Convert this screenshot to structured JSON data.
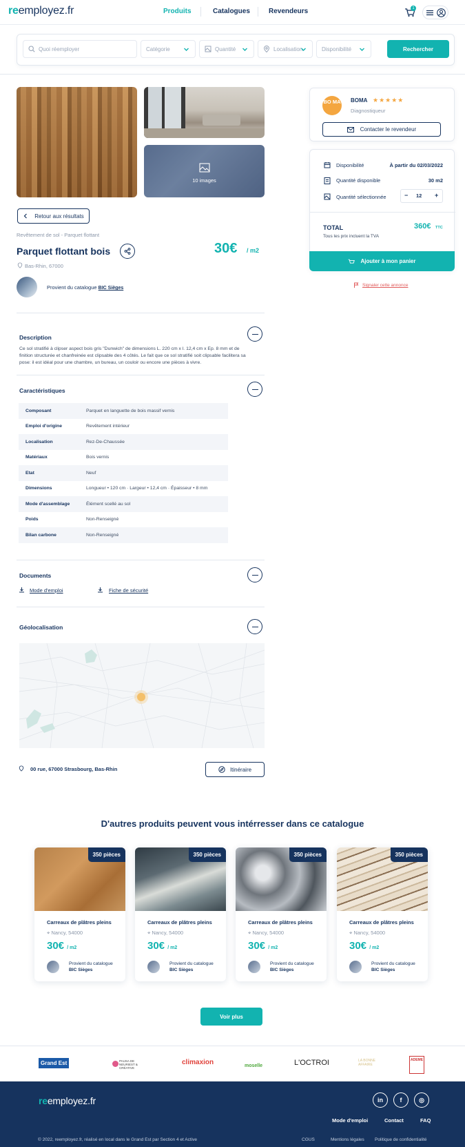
{
  "header": {
    "logo_re": "re",
    "logo_rest": "employez.fr",
    "nav": [
      "Produits",
      "Catalogues",
      "Revendeurs"
    ],
    "cart_count": "1"
  },
  "search": {
    "query_placeholder": "Quoi réemployer",
    "category": "Catégorie",
    "quantity": "Quantité",
    "location": "Localisation",
    "availability": "Disponibilité",
    "button": "Rechercher"
  },
  "gallery": {
    "more_images": "10 images"
  },
  "product": {
    "back": "Retour aux résultats",
    "breadcrumb": "Revêtement de sol - Parquet flottant",
    "title": "Parquet flottant bois",
    "price": "30€",
    "unit": "/ m2",
    "location": "Bas-Rhin, 67000",
    "catalogue_prefix": "Provient du catalogue",
    "catalogue_name": "BIC Sièges"
  },
  "description": {
    "title": "Description",
    "text": "Ce sol stratifié à clipser aspect bois gris \"Dunwich\" de dimensions L. 220 cm x l. 12,4 cm x Ep. 8 mm et de finition structurée et chanfreinée est clipsable des 4 côtés. Le fait que ce sol stratifié soit clipsable facilitera sa pose: il est idéal pour une chambre, un bureau, un couloir ou encore une pièces à vivre."
  },
  "characteristics": {
    "title": "Caractéristiques",
    "rows": [
      {
        "k": "Composant",
        "v": "Parquet en languette de bois massif vernis"
      },
      {
        "k": "Emploi d'origine",
        "v": "Revêtement intérieur"
      },
      {
        "k": "Localisation",
        "v": "Rez-De-Chaussée"
      },
      {
        "k": "Matériaux",
        "v": "Bois vernis"
      },
      {
        "k": "Etat",
        "v": "Neuf"
      },
      {
        "k": "Dimensions",
        "v": "Longueur • 120 cm · Largeur • 12,4 cm · Épaisseur • 8 mm"
      },
      {
        "k": "Mode d'assemblage",
        "v": "Élément scellé au sol"
      },
      {
        "k": "Poids",
        "v": "Non-Renseigné"
      },
      {
        "k": "Bilan carbone",
        "v": "Non-Renseigné"
      }
    ]
  },
  "documents": {
    "title": "Documents",
    "items": [
      "Mode d'emploi",
      "Fiche de sécurité"
    ]
  },
  "geo": {
    "title": "Géolocalisation",
    "address": "00 rue, 67000 Strasbourg, Bas-Rhin",
    "itinerary": "Itinéraire"
  },
  "seller": {
    "name": "BOMA",
    "stars": "★★★★★",
    "role": "Diagnostiqueur",
    "logo_text": "BO MA",
    "contact": "Contacter le revendeur"
  },
  "order": {
    "availability_label": "Disponibilité",
    "availability_value": "À partir du 02/03/2022",
    "qty_available_label": "Quantité disponible",
    "qty_available_value": "30 m2",
    "qty_selected_label": "Quantité sélectionnée",
    "qty_selected_value": "12",
    "minus": "−",
    "plus": "+",
    "total_label": "TOTAL",
    "total_value": "360€",
    "ttc": "TTC",
    "tva_note": "Tous les prix incluent la TVA",
    "add_to_cart": "Ajouter à mon panier",
    "report": "Signaler cette annonce"
  },
  "related": {
    "title": "D'autres produits peuvent vous intérresser dans ce catalogue",
    "cards": [
      {
        "badge": "350 pièces",
        "name": "Carreaux de plâtres pleins",
        "location": "Nancy, 54000",
        "price": "30€",
        "unit": "/ m2",
        "cat1": "Provient du catalogue",
        "cat2": "BIC Sièges"
      },
      {
        "badge": "350 pièces",
        "name": "Carreaux de plâtres pleins",
        "location": "Nancy, 54000",
        "price": "30€",
        "unit": "/ m2",
        "cat1": "Provient du catalogue",
        "cat2": "BIC Sièges"
      },
      {
        "badge": "350 pièces",
        "name": "Carreaux de plâtres pleins",
        "location": "Nancy, 54000",
        "price": "30€",
        "unit": "/ m2",
        "cat1": "Provient du catalogue",
        "cat2": "BIC Sièges"
      },
      {
        "badge": "350 pièces",
        "name": "Carreaux de plâtres pleins",
        "location": "Nancy, 54000",
        "price": "30€",
        "unit": "/ m2",
        "cat1": "Provient du catalogue",
        "cat2": "BIC Sièges"
      }
    ],
    "more": "Voir plus"
  },
  "partners": [
    "Grand Est",
    "PAUSA DE NEURIEST & CRÉATIVE",
    "climaxion",
    "moselle",
    "L'OCTROI",
    "LA BONNE AFFAIRE",
    "ADEME"
  ],
  "footer": {
    "logo_re": "re",
    "logo_rest": "employez.fr",
    "social": [
      "in",
      "f",
      "◎"
    ],
    "links": [
      "Mode d'emploi",
      "Contact",
      "FAQ"
    ],
    "copyright": "© 2022, reemployez.fr, réalisé en local dans le Grand Est par Section 4 et Active",
    "legal": [
      "CGUS",
      "Mentions légales",
      "Politique de confidentialité"
    ]
  },
  "colors": {
    "navy": "#16335e",
    "teal": "#12b3b0",
    "orange": "#f4a640",
    "red": "#e05a5a"
  }
}
